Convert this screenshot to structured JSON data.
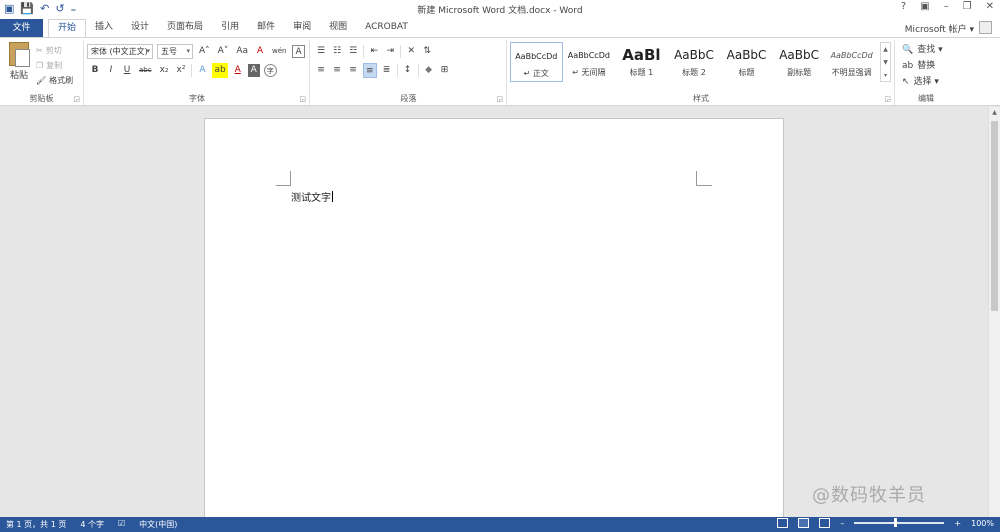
{
  "window": {
    "title": "新建 Microsoft Word 文档.docx - Word",
    "qat": {
      "save": "💾",
      "undo": "↶",
      "redo": "↺",
      "customize": "₌"
    },
    "controls": {
      "help": "?",
      "ribbon_display": "▣",
      "minimize": "–",
      "restore": "❐",
      "close": "✕"
    }
  },
  "tabs": {
    "file": "文件",
    "items": [
      "开始",
      "插入",
      "设计",
      "页面布局",
      "引用",
      "邮件",
      "审阅",
      "视图",
      "ACROBAT"
    ],
    "active": "开始",
    "account": "Microsoft 帐户 ▾"
  },
  "ribbon": {
    "clipboard": {
      "label": "剪贴板",
      "paste": "粘贴",
      "cut": "剪切",
      "copy": "复制",
      "format_painter": "格式刷"
    },
    "font": {
      "label": "字体",
      "font_name": "宋体 (中文正文)",
      "font_size": "五号",
      "grow": "A˄",
      "shrink": "A˅",
      "change_case": "Aa",
      "clear_format": "A",
      "phonetic": "wén",
      "char_border": "A",
      "bold": "B",
      "italic": "I",
      "underline": "U",
      "strikethrough": "abc",
      "subscript": "x₂",
      "superscript": "x²",
      "text_effect": "A",
      "highlight": "ab",
      "font_color": "A",
      "char_shading": "A",
      "enclose": "字"
    },
    "paragraph": {
      "label": "段落",
      "bullets": "☰",
      "numbering": "☷",
      "multilevel": "☲",
      "decrease_indent": "⇤",
      "increase_indent": "⇥",
      "chinese_layout": "✕",
      "sort": "⇅",
      "align_left": "≡",
      "center": "≡",
      "align_right": "≡",
      "justify": "≡",
      "distributed": "≣",
      "line_spacing": "↕",
      "shading": "◆",
      "borders": "⊞"
    },
    "styles": {
      "label": "样式",
      "items": [
        {
          "sample": "AaBbCcDd",
          "name": "↵ 正文",
          "selected": true
        },
        {
          "sample": "AaBbCcDd",
          "name": "↵ 无间隔",
          "selected": false
        },
        {
          "sample": "AaBl",
          "name": "标题 1",
          "selected": false
        },
        {
          "sample": "AaBbC",
          "name": "标题 2",
          "selected": false
        },
        {
          "sample": "AaBbC",
          "name": "标题",
          "selected": false
        },
        {
          "sample": "AaBbC",
          "name": "副标题",
          "selected": false
        },
        {
          "sample": "AaBbCcDd",
          "name": "不明显强调",
          "selected": false
        }
      ]
    },
    "editing": {
      "label": "编辑",
      "find": "查找 ▾",
      "replace": "替换",
      "select": "选择 ▾"
    }
  },
  "document": {
    "text": "测试文字"
  },
  "watermark": "@数码牧羊员",
  "status": {
    "page": "第 1 页，共 1 页",
    "words": "4 个字",
    "proofing_icon": "proofing-icon",
    "language": "中文(中国)",
    "zoom_out": "–",
    "zoom_in": "+",
    "zoom": "100%",
    "zoom_level": 1.0
  },
  "colors": {
    "accent": "#2b579a",
    "font_color": "#c00000",
    "highlight": "#ffff00"
  }
}
